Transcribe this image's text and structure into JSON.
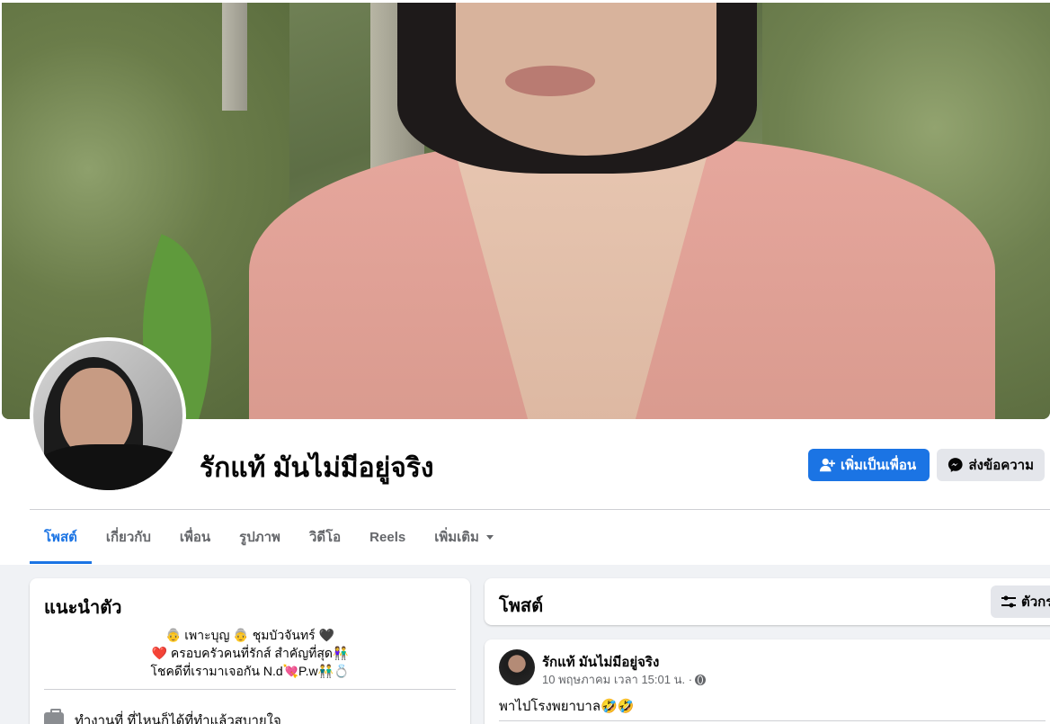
{
  "profile": {
    "name": "รักแท้ มันไม่มีอยู่จริง",
    "add_friend_label": "เพิ่มเป็นเพื่อน",
    "message_label": "ส่งข้อความ",
    "add_friend_icon": "person-plus-icon",
    "message_icon": "messenger-icon"
  },
  "tabs": [
    {
      "label": "โพสต์",
      "active": true
    },
    {
      "label": "เกี่ยวกับ"
    },
    {
      "label": "เพื่อน"
    },
    {
      "label": "รูปภาพ"
    },
    {
      "label": "วิดีโอ"
    },
    {
      "label": "Reels"
    },
    {
      "label": "เพิ่มเติม",
      "dropdown": true
    }
  ],
  "intro": {
    "title": "แนะนำตัว",
    "bio": [
      "👵 เพาะบุญ 👵 ชุมบัวจันทร์ 🖤",
      "❤️ ครอบครัวคนที่รักส์ สำคัญที่สุด👫",
      "โชคดีที่เรามาเจอกัน N.d💘P.w👬💍"
    ],
    "work": "ทำงานที่ ที่ไหนก็ได้ที่ทำแล้วสบายใจ",
    "work_icon": "briefcase-icon"
  },
  "posts_section": {
    "title": "โพสต์",
    "filter_label": "ตัวกร",
    "filter_icon": "sliders-icon"
  },
  "post": {
    "author": "รักแท้ มันไม่มีอยู่จริง",
    "timestamp": "10 พฤษภาคม เวลา 15:01 น. ·",
    "privacy_icon": "globe-icon",
    "text": "พาไปโรงพยาบาล🤣🤣"
  },
  "colors": {
    "accent": "#1b74e4",
    "secondary_button": "#e4e6eb",
    "page_bg": "#f0f2f5"
  }
}
